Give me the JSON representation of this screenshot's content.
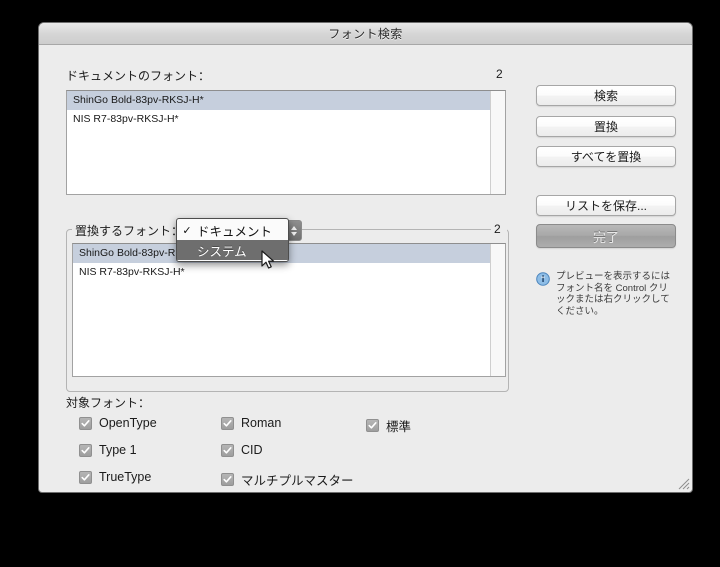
{
  "window": {
    "title": "フォント検索"
  },
  "document_fonts": {
    "label": "ドキュメントのフォント：",
    "count": "2",
    "items": [
      {
        "name": "ShinGo Bold-83pv-RKSJ-H*",
        "selected": true
      },
      {
        "name": "NIS R7-83pv-RKSJ-H*",
        "selected": false
      }
    ]
  },
  "replace_fonts": {
    "label": "置換するフォント：",
    "count": "2",
    "items": [
      {
        "name": "ShinGo Bold-83pv-RKSJ-H*",
        "selected": true
      },
      {
        "name": "NIS R7-83pv-RKSJ-H*",
        "selected": false
      }
    ]
  },
  "source_popup": {
    "selected": "ドキュメント",
    "options": [
      {
        "label": "ドキュメント",
        "checked": true,
        "highlighted": false
      },
      {
        "label": "システム",
        "checked": false,
        "highlighted": true
      }
    ],
    "check_glyph": "✓"
  },
  "buttons": {
    "search": "検索",
    "replace": "置換",
    "replace_all": "すべてを置換",
    "save_list": "リストを保存...",
    "done": "完了"
  },
  "hint": {
    "icon": "info-icon",
    "text": "プレビューを表示するにはフォント名を Control クリックまたは右クリックしてください。"
  },
  "target_fonts": {
    "label": "対象フォント：",
    "checkboxes": [
      {
        "label": "OpenType",
        "checked": true
      },
      {
        "label": "Type 1",
        "checked": true
      },
      {
        "label": "TrueType",
        "checked": true
      },
      {
        "label": "Roman",
        "checked": true
      },
      {
        "label": "CID",
        "checked": true
      },
      {
        "label": "マルチプルマスター",
        "checked": true
      },
      {
        "label": "標準",
        "checked": true
      }
    ]
  },
  "colors": {
    "window_bg": "#ececec",
    "selection": "#c6cfdd",
    "menu_highlight": "#6e6e6e",
    "info_blue": "#6fa8dc"
  }
}
